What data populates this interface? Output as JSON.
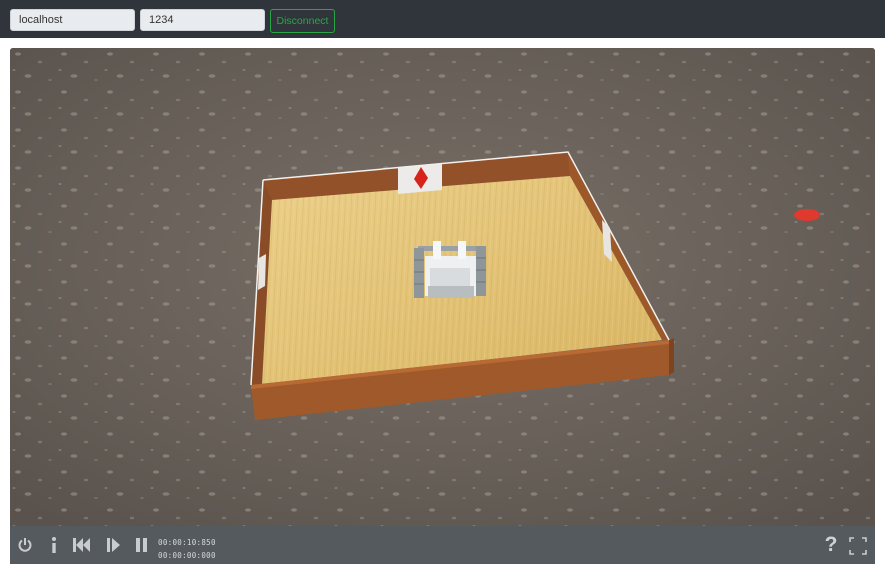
{
  "connection": {
    "host": "localhost",
    "port": "1234",
    "disconnect_label": "Disconnect"
  },
  "colors": {
    "topbar": "#30353b",
    "accent_green": "#28a745",
    "ground": "#6b635b",
    "arena_wall": "#a0592a",
    "arena_floor": "#e3c276",
    "marker_red": "#e03a2e",
    "controls_bar": "#555a5e"
  },
  "viewport": {
    "scene": "3D arena with robot on wooden floor"
  },
  "playback": {
    "current_time": "00:00:10:850",
    "total_time": "00:00:00:000",
    "icons": [
      "power-icon",
      "info-icon",
      "rewind-icon",
      "step-icon",
      "pause-icon"
    ],
    "help_label": "?",
    "fullscreen_icon": "fullscreen-icon"
  }
}
